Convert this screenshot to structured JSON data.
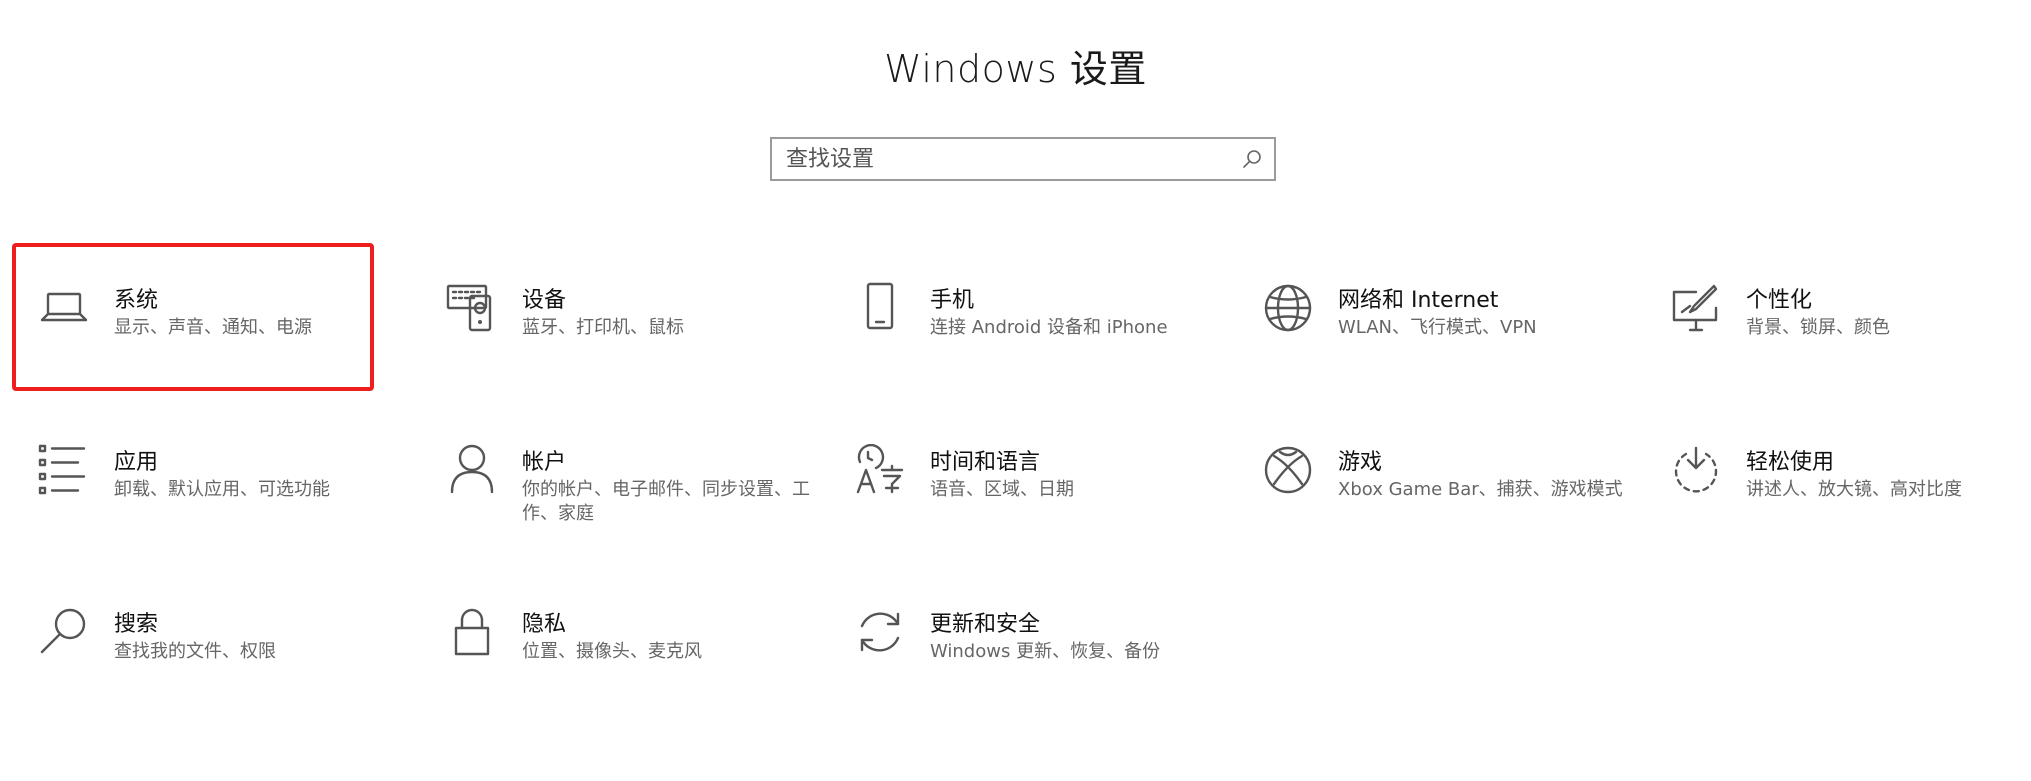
{
  "header": {
    "title": "Windows 设置"
  },
  "search": {
    "placeholder": "查找设置"
  },
  "tiles": [
    {
      "icon": "laptop-icon",
      "title": "系统",
      "desc": "显示、声音、通知、电源"
    },
    {
      "icon": "devices-icon",
      "title": "设备",
      "desc": "蓝牙、打印机、鼠标"
    },
    {
      "icon": "phone-icon",
      "title": "手机",
      "desc": "连接 Android 设备和 iPhone"
    },
    {
      "icon": "globe-icon",
      "title": "网络和 Internet",
      "desc": "WLAN、飞行模式、VPN"
    },
    {
      "icon": "personalization-icon",
      "title": "个性化",
      "desc": "背景、锁屏、颜色"
    },
    {
      "icon": "apps-list-icon",
      "title": "应用",
      "desc": "卸载、默认应用、可选功能"
    },
    {
      "icon": "person-icon",
      "title": "帐户",
      "desc": "你的帐户、电子邮件、同步设置、工作、家庭"
    },
    {
      "icon": "time-language-icon",
      "title": "时间和语言",
      "desc": "语音、区域、日期"
    },
    {
      "icon": "xbox-icon",
      "title": "游戏",
      "desc": "Xbox Game Bar、捕获、游戏模式"
    },
    {
      "icon": "ease-of-access-icon",
      "title": "轻松使用",
      "desc": "讲述人、放大镜、高对比度"
    },
    {
      "icon": "search-icon",
      "title": "搜索",
      "desc": "查找我的文件、权限"
    },
    {
      "icon": "lock-icon",
      "title": "隐私",
      "desc": "位置、摄像头、麦克风"
    },
    {
      "icon": "update-sync-icon",
      "title": "更新和安全",
      "desc": "Windows 更新、恢复、备份"
    }
  ],
  "colors": {
    "highlight": "#ef1e1e",
    "icon": "#555555",
    "description": "#666666"
  }
}
